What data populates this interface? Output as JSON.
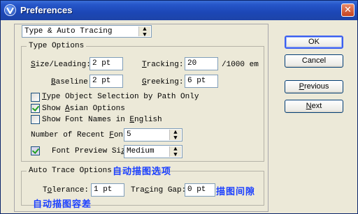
{
  "window": {
    "title": "Preferences",
    "accent": "#1c47b6"
  },
  "section_dropdown": {
    "value": "Type & Auto Tracing"
  },
  "type_options": {
    "group_label": "Type Options",
    "size_leading": {
      "label_pre": "S",
      "label_rest": "ize/Leading:",
      "value": "2 pt"
    },
    "tracking": {
      "label_pre": "T",
      "label_rest": "racking:",
      "value": "20",
      "unit": "/1000 em"
    },
    "baseline": {
      "label_pre": "B",
      "label_rest": "aseline",
      "value": "2 pt"
    },
    "greeking": {
      "label_pre": "G",
      "label_rest": "reeking:",
      "value": "6 pt"
    },
    "type_object_selection": {
      "pre": "T",
      "label": "ype Object Selection by Path Only",
      "checked": false
    },
    "show_asian_options": {
      "pre": "Show ",
      "ul": "A",
      "post": "sian Options",
      "checked": true
    },
    "show_font_names_english": {
      "pre": "Show Font Names in ",
      "ul": "E",
      "post": "nglish",
      "checked": false
    },
    "recent_fonts": {
      "pre": "Number of Recent ",
      "ul": "F",
      "post": "onts",
      "value": "5"
    },
    "font_preview": {
      "pre": "Font Preview Si",
      "ul": "z",
      "post": "e",
      "value": "Medium",
      "checked": true
    }
  },
  "auto_trace": {
    "group_label": "Auto Trace Options",
    "annotation_group": "自动描图选项",
    "tolerance": {
      "pre": "T",
      "ul": "o",
      "post": "lerance:",
      "value": "1 pt"
    },
    "tracing_gap": {
      "pre": "Tra",
      "ul": "c",
      "post": "ing Gap:",
      "value": "0 pt"
    },
    "annotation_gap": "描图间隙",
    "annotation_tolerance": "自动描图容差"
  },
  "buttons": {
    "ok": "OK",
    "cancel": "Cancel",
    "previous_ul": "P",
    "previous_rest": "revious",
    "next_ul": "N",
    "next_rest": "ext"
  }
}
